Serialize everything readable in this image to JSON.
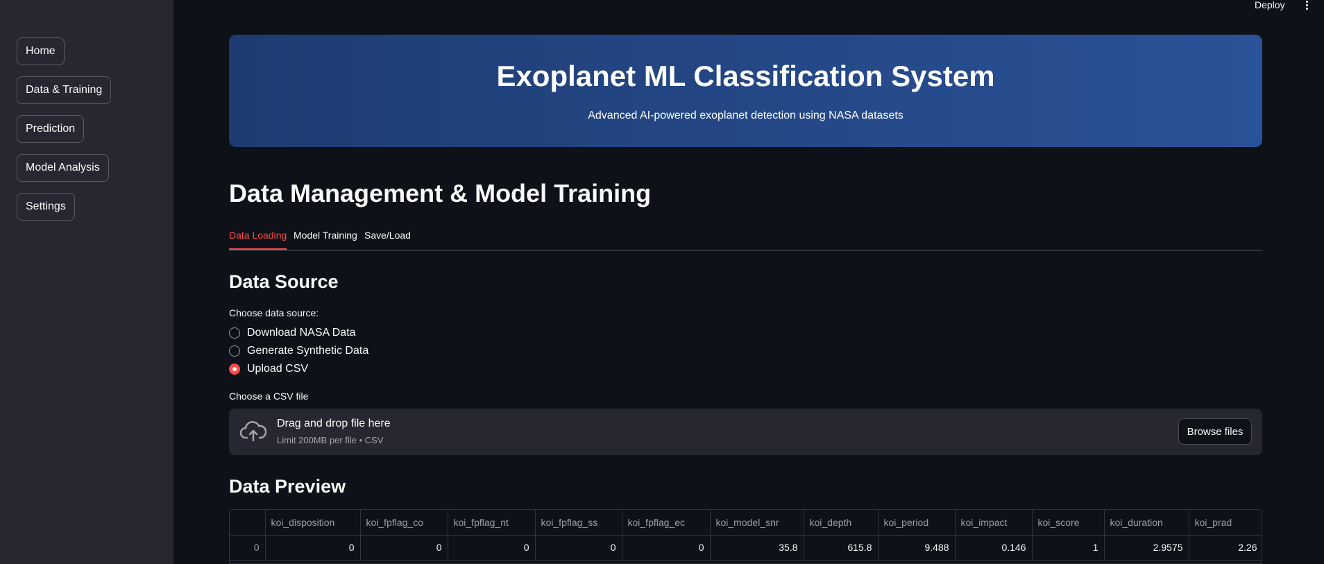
{
  "topbar": {
    "deploy_label": "Deploy",
    "menu_icon": "vertical-ellipsis-icon"
  },
  "sidebar": {
    "items": [
      {
        "label": "Home"
      },
      {
        "label": "Data & Training"
      },
      {
        "label": "Prediction"
      },
      {
        "label": "Model Analysis"
      },
      {
        "label": "Settings"
      }
    ]
  },
  "hero": {
    "title": "Exoplanet ML Classification System",
    "subtitle": "Advanced AI-powered exoplanet detection using NASA datasets",
    "gradient_colors": [
      "#1e3c72",
      "#2a5298"
    ]
  },
  "page_title": "Data Management & Model Training",
  "tabs": [
    {
      "label": "Data Loading",
      "active": true
    },
    {
      "label": "Model Training",
      "active": false
    },
    {
      "label": "Save/Load",
      "active": false
    }
  ],
  "data_source": {
    "title": "Data Source",
    "prompt": "Choose data source:",
    "options": [
      {
        "label": "Download NASA Data",
        "checked": false
      },
      {
        "label": "Generate Synthetic Data",
        "checked": false
      },
      {
        "label": "Upload CSV",
        "checked": true
      }
    ]
  },
  "uploader": {
    "label": "Choose a CSV file",
    "main_text": "Drag and drop file here",
    "sub_text": "Limit 200MB per file • CSV",
    "browse_label": "Browse files",
    "icon": "cloud-upload-icon"
  },
  "preview": {
    "title": "Data Preview",
    "columns": [
      "",
      "koi_disposition",
      "koi_fpflag_co",
      "koi_fpflag_nt",
      "koi_fpflag_ss",
      "koi_fpflag_ec",
      "koi_model_snr",
      "koi_depth",
      "koi_period",
      "koi_impact",
      "koi_score",
      "koi_duration",
      "koi_prad"
    ],
    "rows": [
      [
        "0",
        "0",
        "0",
        "0",
        "0",
        "0",
        "35.8",
        "615.8",
        "9.488",
        "0.146",
        "1",
        "2.9575",
        "2.26"
      ]
    ]
  },
  "colors": {
    "accent": "#ff4b4b",
    "background": "#0e1117",
    "sidebar": "#262730"
  }
}
